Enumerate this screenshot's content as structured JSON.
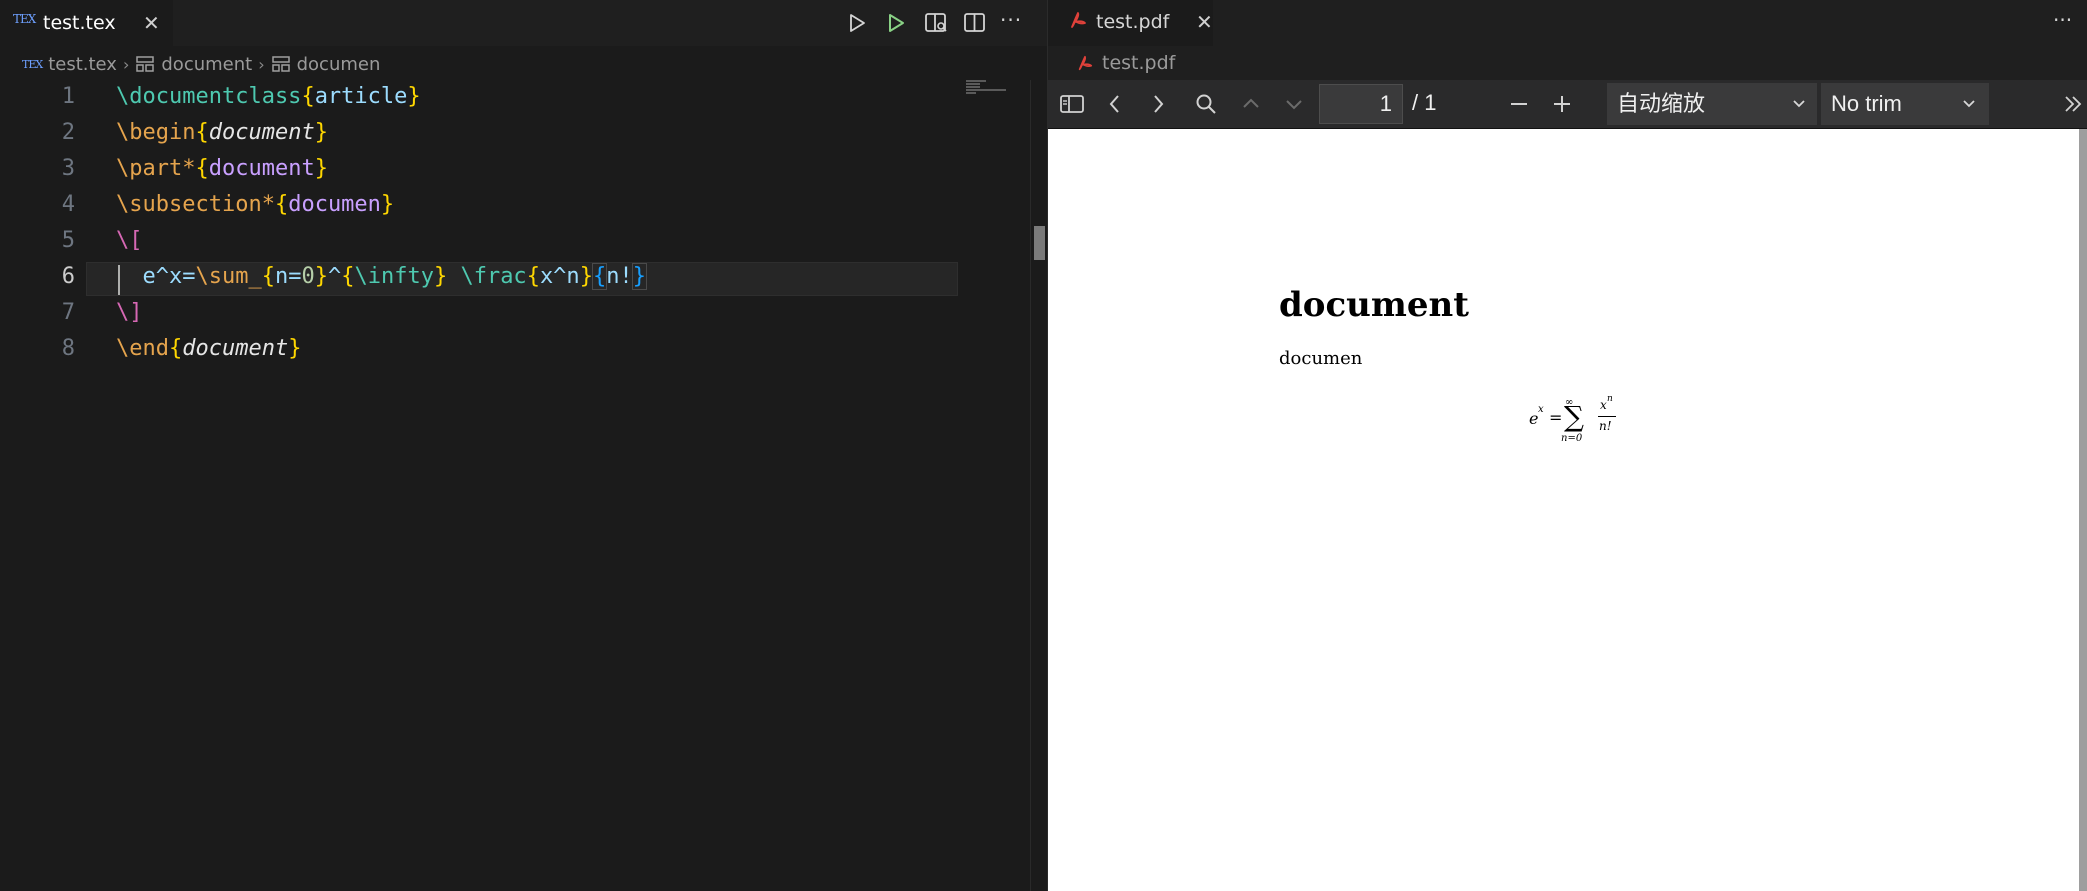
{
  "left_editor": {
    "tab": {
      "icon": "tex-file-icon",
      "icon_text": "TEX",
      "title": "test.tex",
      "close": "✕"
    },
    "actions": [
      {
        "name": "run-icon",
        "glyph": "▷"
      },
      {
        "name": "run-green-icon",
        "glyph": "▷"
      },
      {
        "name": "open-preview-icon",
        "glyph": ""
      },
      {
        "name": "split-editor-icon",
        "glyph": ""
      },
      {
        "name": "more-actions-icon",
        "glyph": "···"
      }
    ],
    "breadcrumbs": [
      {
        "icon": "tex-file-icon",
        "label": "test.tex"
      },
      {
        "icon": "symbol-structure-icon",
        "label": "document"
      },
      {
        "icon": "symbol-structure-icon",
        "label": "documen"
      }
    ],
    "line_numbers": [
      "1",
      "2",
      "3",
      "4",
      "5",
      "6",
      "7",
      "8"
    ],
    "active_line": "6",
    "code": {
      "l1": {
        "cmd": "\\documentclass",
        "open": "{",
        "arg": "article",
        "close": "}"
      },
      "l2": {
        "cmd": "\\begin",
        "open": "{",
        "arg": "document",
        "close": "}"
      },
      "l3": {
        "cmd": "\\part*",
        "open": "{",
        "arg": "document",
        "close": "}"
      },
      "l4": {
        "cmd": "\\subsection*",
        "open": "{",
        "arg": "documen",
        "close": "}"
      },
      "l5": {
        "cmd": "\\["
      },
      "l6": {
        "indent": "  ",
        "a": "e^x=",
        "b": "\\sum_",
        "c": "{",
        "d": "n=",
        "e": "0",
        "f": "}",
        "g": "^",
        "h": "{",
        "i": "\\infty",
        "j": "}",
        "k": " ",
        "l": "\\frac",
        "m": "{",
        "n": "x^n",
        "o": "}",
        "p": "{",
        "q": "n!",
        "r": "}"
      },
      "l7": {
        "cmd": "\\]"
      },
      "l8": {
        "cmd": "\\end",
        "open": "{",
        "arg": "document",
        "close": "}"
      }
    }
  },
  "right_editor": {
    "tab": {
      "icon": "pdf-file-icon",
      "title": "test.pdf",
      "close": "✕"
    },
    "more": "···",
    "breadcrumb": {
      "icon": "pdf-file-icon",
      "label": "test.pdf"
    },
    "toolbar": {
      "page_current": "1",
      "page_total": "/ 1",
      "zoom_select": "自动缩放",
      "trim_select": "No trim",
      "minus": "—",
      "plus": "+",
      "more": "»"
    },
    "document": {
      "part_title": "document",
      "subsection": "documen",
      "equation": {
        "lhs_base": "e",
        "lhs_exp": "x",
        "equals": "=",
        "sum": "∑",
        "sum_upper": "∞",
        "sum_lower": "n=0",
        "num": "x",
        "num_exp": "n",
        "den": "n!"
      }
    }
  },
  "colors": {
    "editor_bg": "#1b1b1b",
    "pdf_icon": "#e0413a",
    "run_green": "#89d185"
  }
}
